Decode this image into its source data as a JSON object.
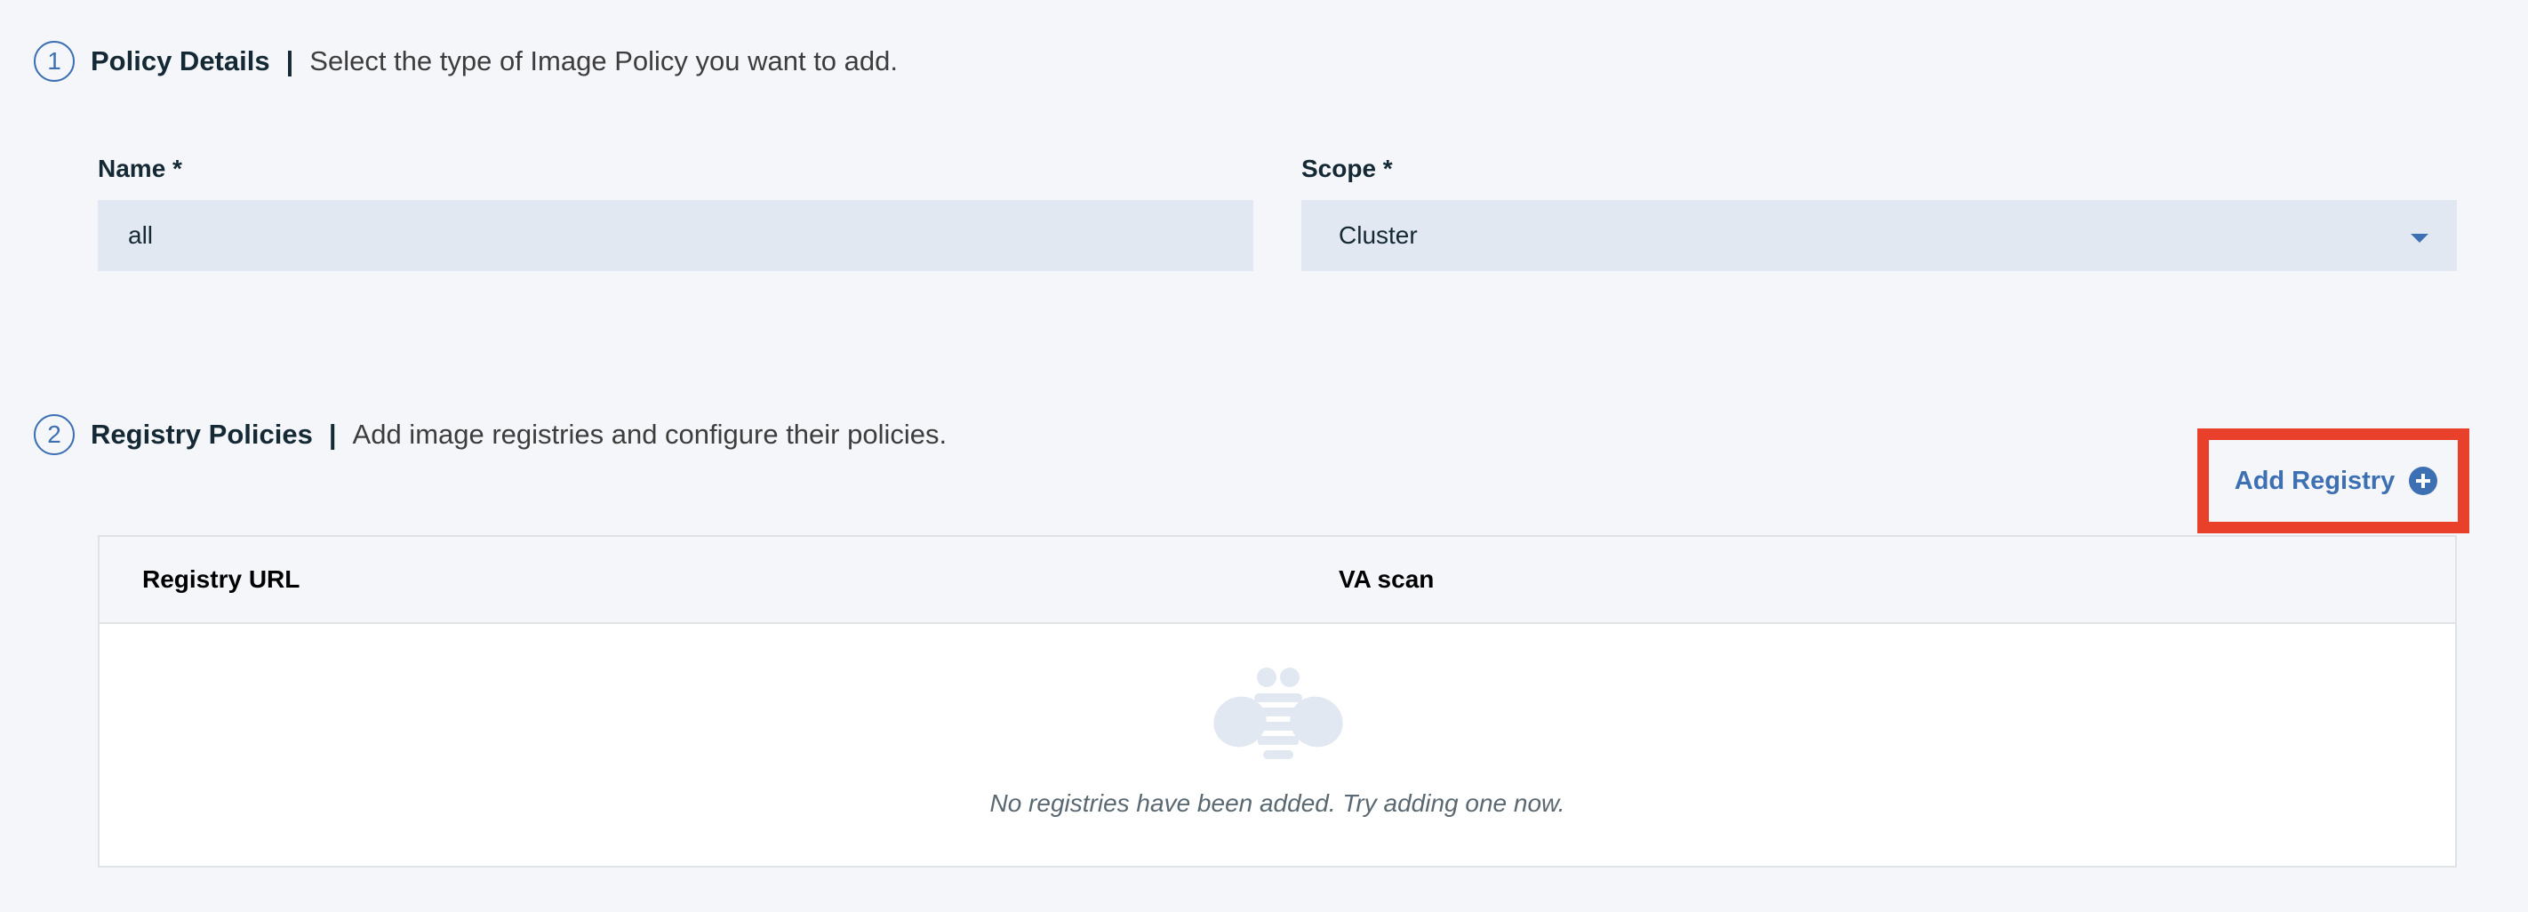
{
  "step1": {
    "number": "1",
    "title": "Policy Details",
    "separator": "|",
    "description": "Select the type of Image Policy you want to add."
  },
  "name_field": {
    "label": "Name *",
    "value": "all"
  },
  "scope_field": {
    "label": "Scope *",
    "value": "Cluster"
  },
  "step2": {
    "number": "2",
    "title": "Registry Policies",
    "separator": "|",
    "description": "Add image registries and configure their policies."
  },
  "add_registry": {
    "label": "Add Registry",
    "icon": "add-circle-icon"
  },
  "table": {
    "columns": [
      "Registry URL",
      "VA scan"
    ],
    "empty_message": "No registries have been added. Try adding one now.",
    "empty_icon": "bee-icon"
  },
  "colors": {
    "accent": "#3d70b2",
    "highlight": "#e8402a",
    "field_bg": "#e1e8f2",
    "page_bg": "#f4f6fa"
  }
}
